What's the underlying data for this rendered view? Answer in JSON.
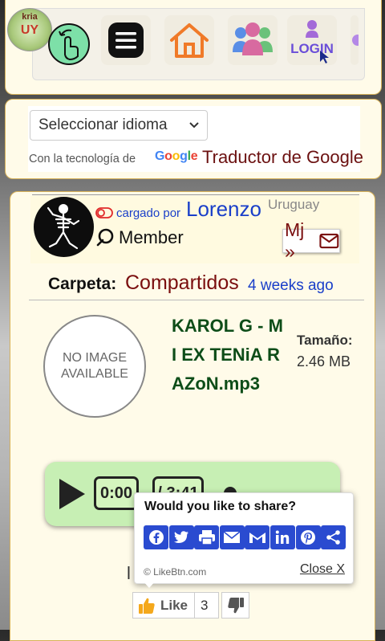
{
  "logo": {
    "line1": "kria",
    "line2": "UY"
  },
  "nav_tiles": [
    {
      "icon": "hand-gesture-icon"
    },
    {
      "icon": "hamburger-menu-icon"
    },
    {
      "icon": "home-icon"
    },
    {
      "icon": "members-icon"
    },
    {
      "icon": "login-icon",
      "label": "LOGIN"
    },
    {
      "icon": "partial-tile-icon"
    }
  ],
  "translate": {
    "select_value": "Seleccionar idioma",
    "powered_by": "Con la tecnología de",
    "google_logo": "Google",
    "translator_link": "Traductor de Google"
  },
  "uploader": {
    "uploaded_by": "cargado por",
    "name": "Lorenzo",
    "country": "Uruguay",
    "role": "Member",
    "pm_label": "Mj »"
  },
  "folder": {
    "label": "Carpeta:",
    "name": "Compartidos",
    "time": "4 weeks ago"
  },
  "file": {
    "no_image_line1": "NO IMAGE",
    "no_image_line2": "AVAILABLE",
    "name": "KAROL G - MI EX TENiA RAZoN.mp3",
    "size_label": "Tamaño:",
    "size_value": "2.46 MB"
  },
  "player": {
    "current_time": "0:00",
    "total_time": "/ 3:41"
  },
  "share": {
    "title": "Would you like to share?",
    "buttons": [
      "facebook-icon",
      "twitter-icon",
      "print-icon",
      "email-icon",
      "gmail-icon",
      "linkedin-icon",
      "pinterest-icon",
      "share-icon"
    ],
    "credit": "© LikeBtn.com",
    "close": "Close X"
  },
  "partial_text": "l",
  "like": {
    "label": "Like",
    "count": "3"
  },
  "colors": {
    "panel_bg": "#fffbe9",
    "panel_border": "#d8b25a",
    "link_blue": "#1a3fc9",
    "maroon": "#7a0e0e",
    "file_green": "#0d4d18",
    "player_green": "#c7efb4",
    "share_blue": "#2a4bd0"
  }
}
